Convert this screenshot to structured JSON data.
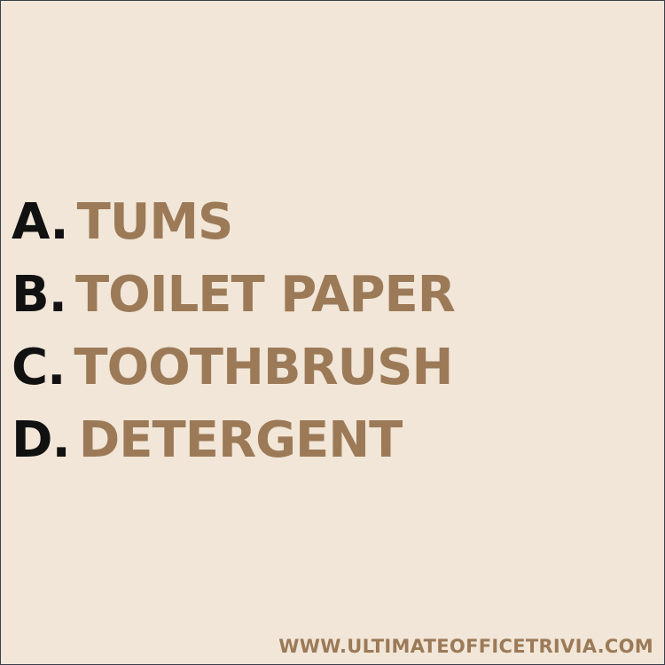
{
  "answers": [
    {
      "letter": "A.",
      "text": "TUMS"
    },
    {
      "letter": "B.",
      "text": "TOILET PAPER"
    },
    {
      "letter": "C.",
      "text": "TOOTHBRUSH"
    },
    {
      "letter": "D.",
      "text": "DETERGENT"
    }
  ],
  "footer": {
    "url": "WWW.ULTIMATEOFFICETRIVIA.COM"
  },
  "colors": {
    "background": "#f1e6d8",
    "letter": "#111111",
    "answer_text": "#9c7a57"
  }
}
